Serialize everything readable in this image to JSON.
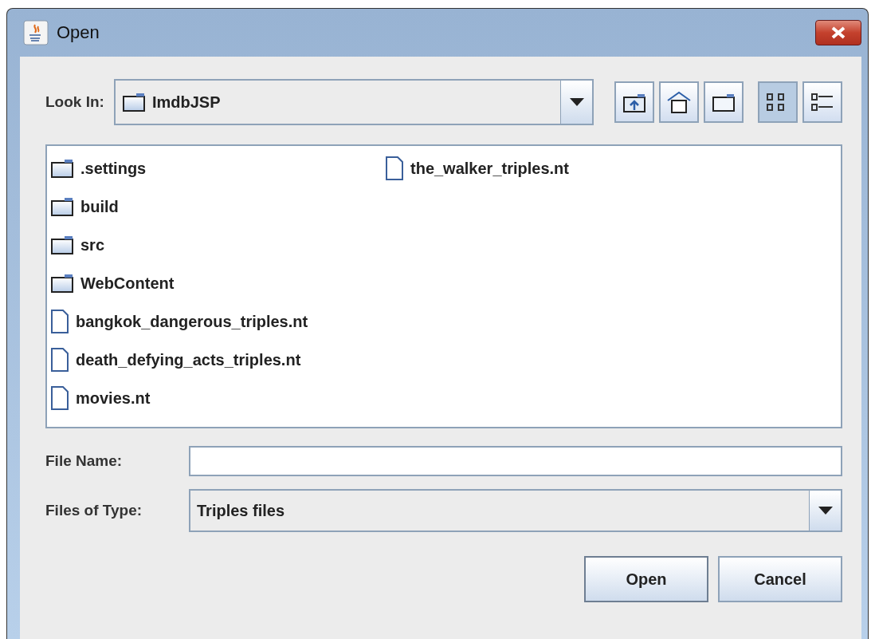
{
  "window": {
    "title": "Open"
  },
  "look_in": {
    "label": "Look In:",
    "value": "ImdbJSP"
  },
  "toolbar": [
    {
      "kind": "up"
    },
    {
      "kind": "home"
    },
    {
      "kind": "new-folder"
    },
    {
      "kind": "list",
      "selected": true
    },
    {
      "kind": "details",
      "selected": false
    }
  ],
  "files": [
    [
      {
        "name": ".settings",
        "kind": "folder"
      },
      {
        "name": "build",
        "kind": "folder"
      },
      {
        "name": "src",
        "kind": "folder"
      },
      {
        "name": "WebContent",
        "kind": "folder"
      },
      {
        "name": "bangkok_dangerous_triples.nt",
        "kind": "file"
      },
      {
        "name": "death_defying_acts_triples.nt",
        "kind": "file"
      },
      {
        "name": "movies.nt",
        "kind": "file"
      }
    ],
    [
      {
        "name": "the_walker_triples.nt",
        "kind": "file"
      }
    ]
  ],
  "file_name": {
    "label": "File Name:"
  },
  "file_type": {
    "label": "Files of Type:",
    "value": "Triples files"
  },
  "buttons": [
    "Open",
    "Cancel"
  ]
}
